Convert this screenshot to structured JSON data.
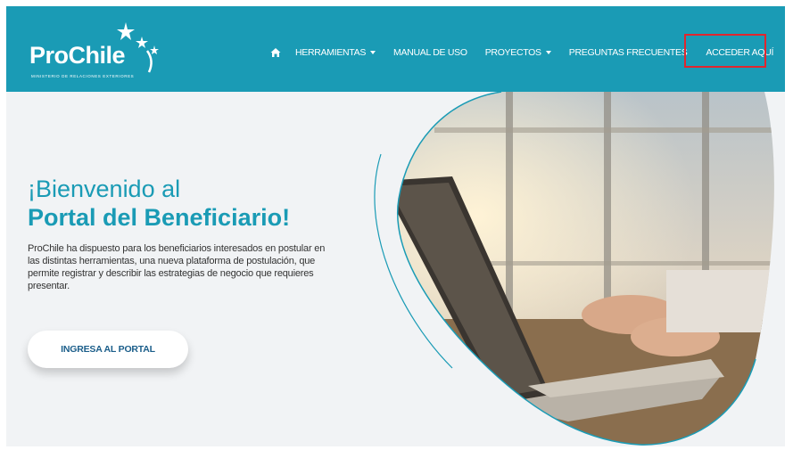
{
  "brand": {
    "name": "ProChile",
    "subtitle": "MINISTERIO DE RELACIONES EXTERIORES"
  },
  "nav": {
    "home_icon": "home-icon",
    "items": [
      {
        "label": "HERRAMIENTAS",
        "dropdown": true
      },
      {
        "label": "MANUAL DE USO",
        "dropdown": false
      },
      {
        "label": "PROYECTOS",
        "dropdown": true
      },
      {
        "label": "PREGUNTAS FRECUENTES",
        "dropdown": false
      },
      {
        "label": "ACCEDER AQUÍ",
        "dropdown": false,
        "highlighted": true
      }
    ]
  },
  "hero": {
    "title_line1": "¡Bienvenido al",
    "title_line2": "Portal del Beneficiario!",
    "description": "ProChile ha dispuesto para los beneficiarios interesados en postular en las distintas herramientas, una nueva plataforma de postulación, que permite registrar y describir las estrategias de negocio que requieres presentar.",
    "cta_label": "INGRESA AL PORTAL"
  },
  "colors": {
    "header_bg": "#1a9bb5",
    "accent": "#1a9bb5",
    "highlight_border": "#e0262e",
    "page_bg": "#f1f3f5"
  }
}
